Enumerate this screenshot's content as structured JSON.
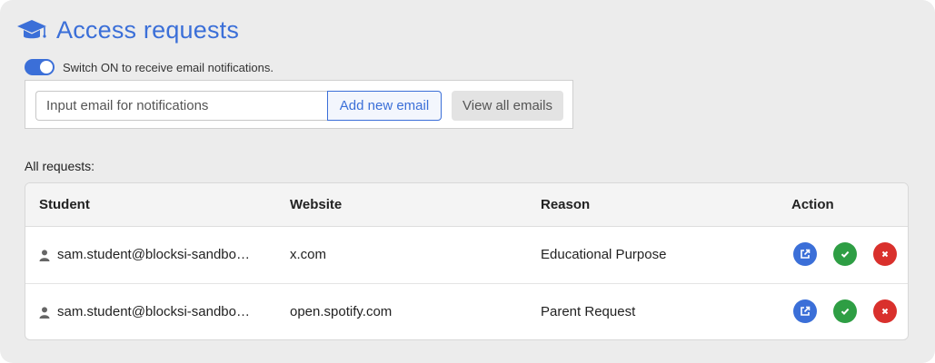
{
  "header": {
    "title": "Access requests",
    "icon": "graduation-cap-icon"
  },
  "notifications": {
    "toggle_on": true,
    "toggle_label": "Switch ON to receive email notifications.",
    "email_placeholder": "Input email for notifications",
    "add_button": "Add new email",
    "view_button": "View all emails"
  },
  "requests": {
    "section_label": "All requests:",
    "columns": [
      "Student",
      "Website",
      "Reason",
      "Action"
    ],
    "rows": [
      {
        "student": "sam.student@blocksi-sandbo…",
        "website": "x.com",
        "reason": "Educational Purpose"
      },
      {
        "student": "sam.student@blocksi-sandbo…",
        "website": "open.spotify.com",
        "reason": "Parent Request"
      }
    ]
  },
  "colors": {
    "accent": "#3b6fd8",
    "open": "#3b6fd8",
    "approve": "#2e9e44",
    "deny": "#d9302c"
  }
}
